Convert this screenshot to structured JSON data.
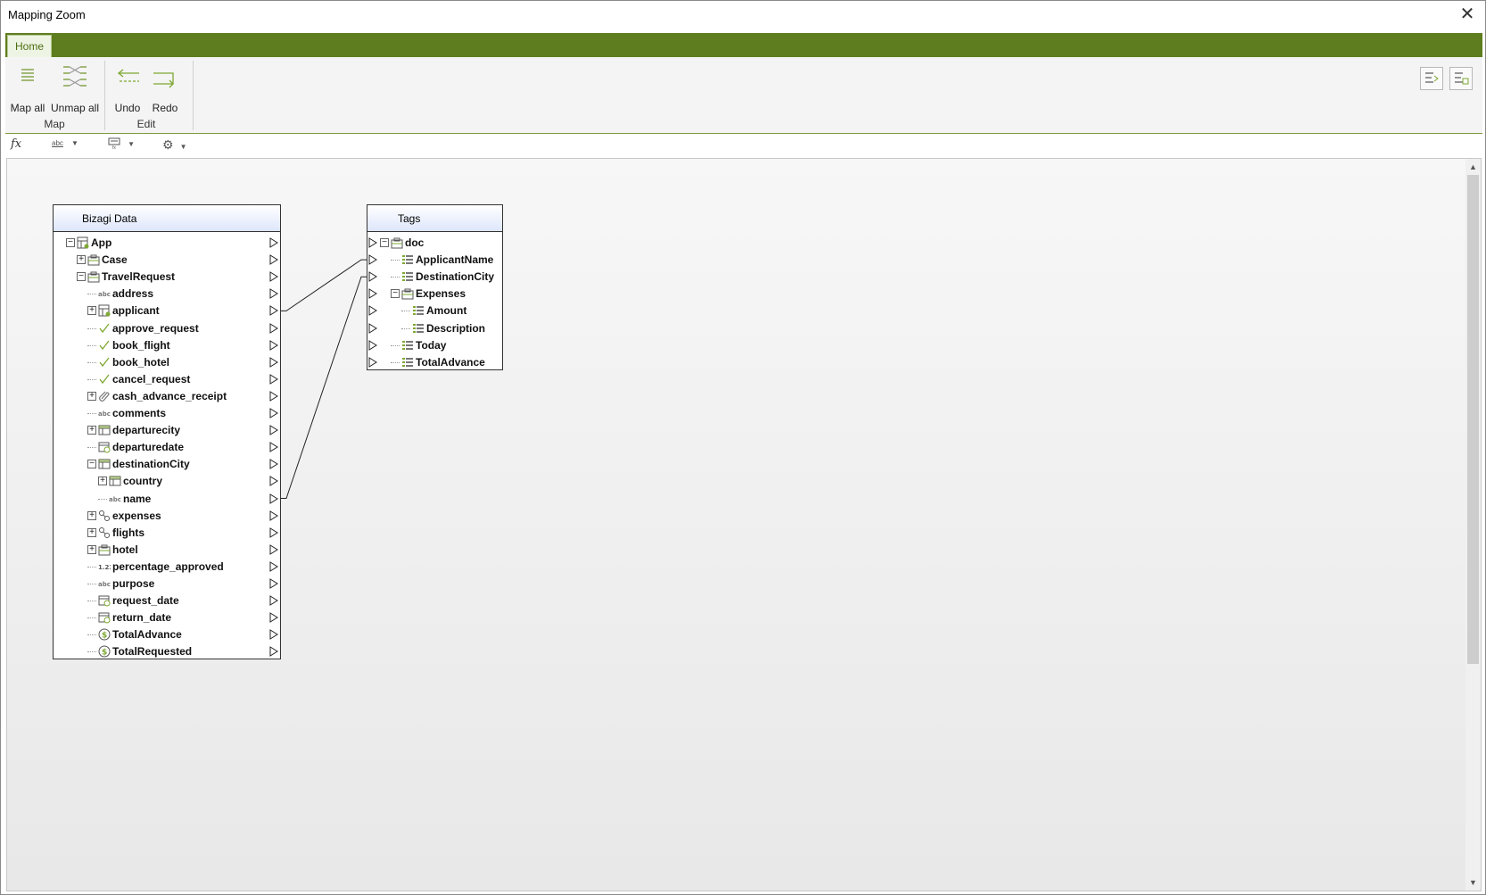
{
  "window": {
    "title": "Mapping Zoom"
  },
  "ribbon": {
    "tabs": [
      {
        "label": "Home"
      }
    ],
    "groups": [
      {
        "label": "Map",
        "buttons": [
          {
            "label": "Map all",
            "icon": "map-all-icon"
          },
          {
            "label": "Unmap all",
            "icon": "unmap-all-icon"
          }
        ]
      },
      {
        "label": "Edit",
        "buttons": [
          {
            "label": "Undo",
            "icon": "undo-icon"
          },
          {
            "label": "Redo",
            "icon": "redo-icon"
          }
        ]
      }
    ],
    "right_icons": [
      "layout-left-icon",
      "layout-right-icon"
    ]
  },
  "toolbar": {
    "items": [
      {
        "icon": "fx-icon",
        "label": "fx"
      },
      {
        "icon": "text-format-icon",
        "label": "abc"
      },
      {
        "icon": "display-settings-icon",
        "label": ""
      },
      {
        "icon": "gear-icon",
        "label": ""
      }
    ]
  },
  "panels": {
    "source": {
      "title": "Bizagi Data",
      "rows": [
        {
          "label": "App",
          "icon": "entity-icon",
          "expander": "−"
        },
        {
          "label": "Case",
          "icon": "case-icon",
          "expander": "+"
        },
        {
          "label": "TravelRequest",
          "icon": "case-icon",
          "expander": "−"
        },
        {
          "label": "address",
          "icon": "text-type-icon",
          "expander": ""
        },
        {
          "label": "applicant",
          "icon": "entity-icon",
          "expander": "+"
        },
        {
          "label": "approve_request",
          "icon": "check-icon",
          "expander": ""
        },
        {
          "label": "book_flight",
          "icon": "check-icon",
          "expander": ""
        },
        {
          "label": "book_hotel",
          "icon": "check-icon",
          "expander": ""
        },
        {
          "label": "cancel_request",
          "icon": "check-icon",
          "expander": ""
        },
        {
          "label": "cash_advance_receipt",
          "icon": "attachment-icon",
          "expander": "+"
        },
        {
          "label": "comments",
          "icon": "text-type-icon",
          "expander": ""
        },
        {
          "label": "departurecity",
          "icon": "table-icon",
          "expander": "+"
        },
        {
          "label": "departuredate",
          "icon": "date-icon",
          "expander": ""
        },
        {
          "label": "destinationCity",
          "icon": "table-icon",
          "expander": "−"
        },
        {
          "label": "country",
          "icon": "table-icon",
          "expander": "+"
        },
        {
          "label": "name",
          "icon": "text-type-icon",
          "expander": ""
        },
        {
          "label": "expenses",
          "icon": "collection-icon",
          "expander": "+"
        },
        {
          "label": "flights",
          "icon": "collection-icon",
          "expander": "+"
        },
        {
          "label": "hotel",
          "icon": "case-icon",
          "expander": "+"
        },
        {
          "label": "percentage_approved",
          "icon": "number-type-icon",
          "expander": ""
        },
        {
          "label": "purpose",
          "icon": "text-type-icon",
          "expander": ""
        },
        {
          "label": "request_date",
          "icon": "date-icon",
          "expander": ""
        },
        {
          "label": "return_date",
          "icon": "date-icon",
          "expander": ""
        },
        {
          "label": "TotalAdvance",
          "icon": "currency-icon",
          "expander": ""
        },
        {
          "label": "TotalRequested",
          "icon": "currency-icon",
          "expander": ""
        }
      ]
    },
    "target": {
      "title": "Tags",
      "rows": [
        {
          "label": "doc",
          "icon": "case-icon",
          "expander": "−"
        },
        {
          "label": "ApplicantName",
          "icon": "field-icon",
          "expander": ""
        },
        {
          "label": "DestinationCity",
          "icon": "field-icon",
          "expander": ""
        },
        {
          "label": "Expenses",
          "icon": "case-icon",
          "expander": "−"
        },
        {
          "label": "Amount",
          "icon": "field-icon",
          "expander": ""
        },
        {
          "label": "Description",
          "icon": "field-icon",
          "expander": ""
        },
        {
          "label": "Today",
          "icon": "field-icon",
          "expander": ""
        },
        {
          "label": "TotalAdvance",
          "icon": "field-icon",
          "expander": ""
        }
      ]
    }
  },
  "mappings": [
    {
      "from": "applicant",
      "to": "ApplicantName"
    },
    {
      "from": "name",
      "to": "DestinationCity"
    }
  ],
  "colors": {
    "accent": "#5e7d1e",
    "icon_green": "#7ea832"
  }
}
